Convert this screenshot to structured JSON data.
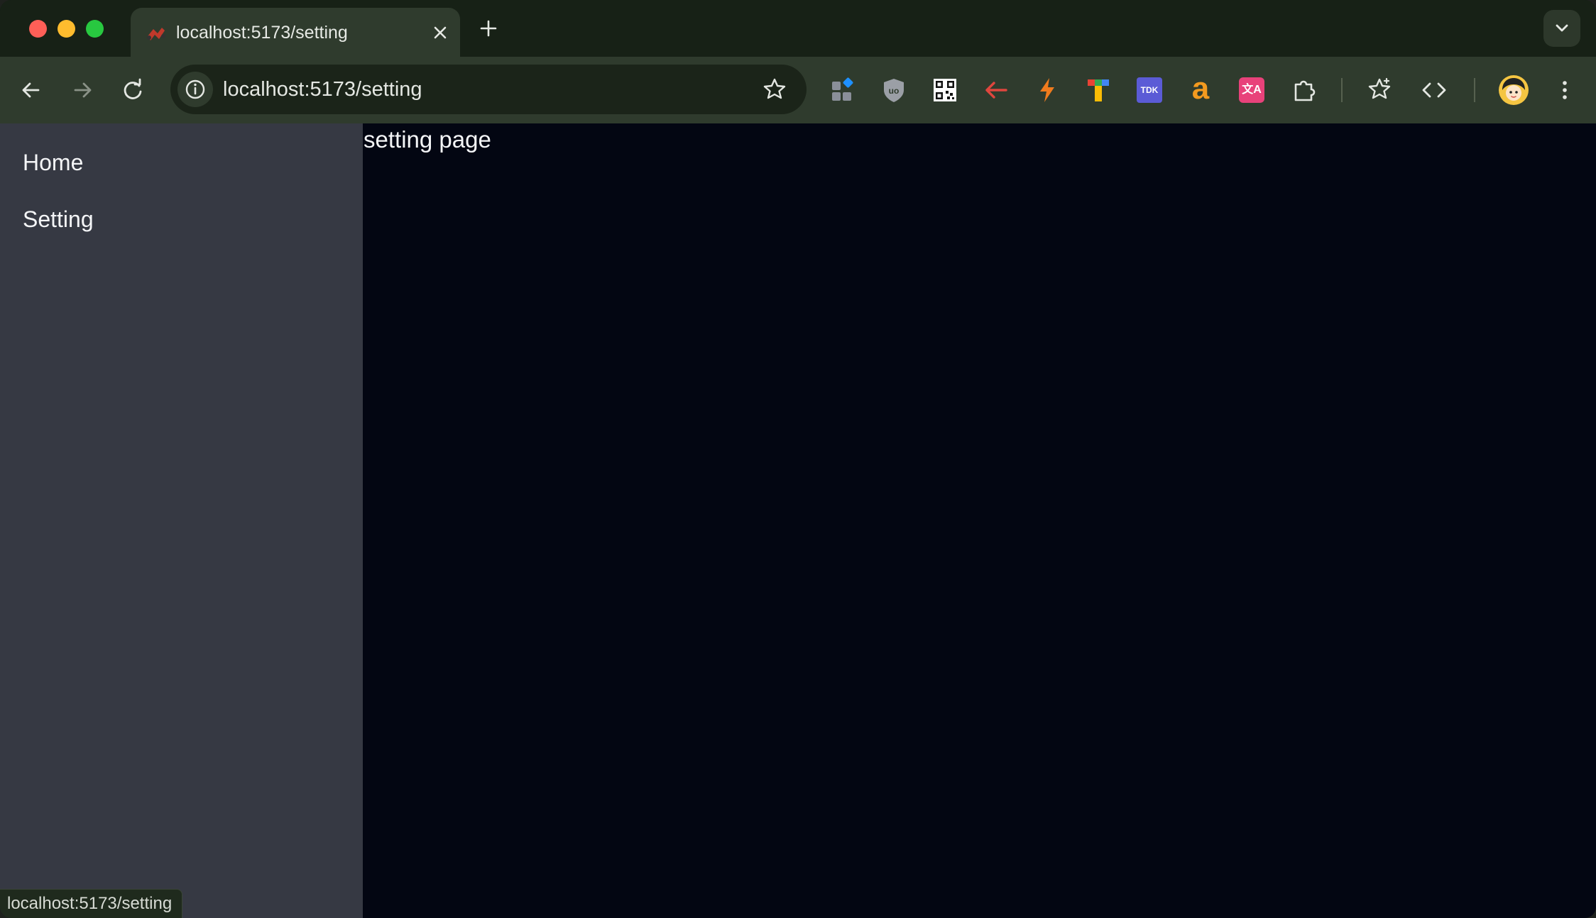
{
  "browser": {
    "tab": {
      "title": "localhost:5173/setting"
    },
    "address_bar": {
      "url": "localhost:5173/setting"
    },
    "extensions": [
      "grid-extension-icon",
      "ublock-shield-icon",
      "qr-code-icon",
      "red-arrow-back-icon",
      "lightning-bolt-icon",
      "colorful-t-icon",
      "tdk-icon",
      "amazon-a-icon",
      "translate-icon",
      "puzzle-piece-icon"
    ],
    "badges": {
      "tdk": "TDK",
      "amazon": "a",
      "translate": "文A"
    },
    "status_bar": "localhost:5173/setting"
  },
  "sidebar": {
    "items": [
      {
        "label": "Home"
      },
      {
        "label": "Setting"
      }
    ]
  },
  "main": {
    "text": "setting page"
  },
  "colors": {
    "sidebar_bg": "#363943",
    "page_bg": "#030612",
    "toolbar_bg": "#2f3b2d",
    "tabstrip_bg": "#172116"
  }
}
